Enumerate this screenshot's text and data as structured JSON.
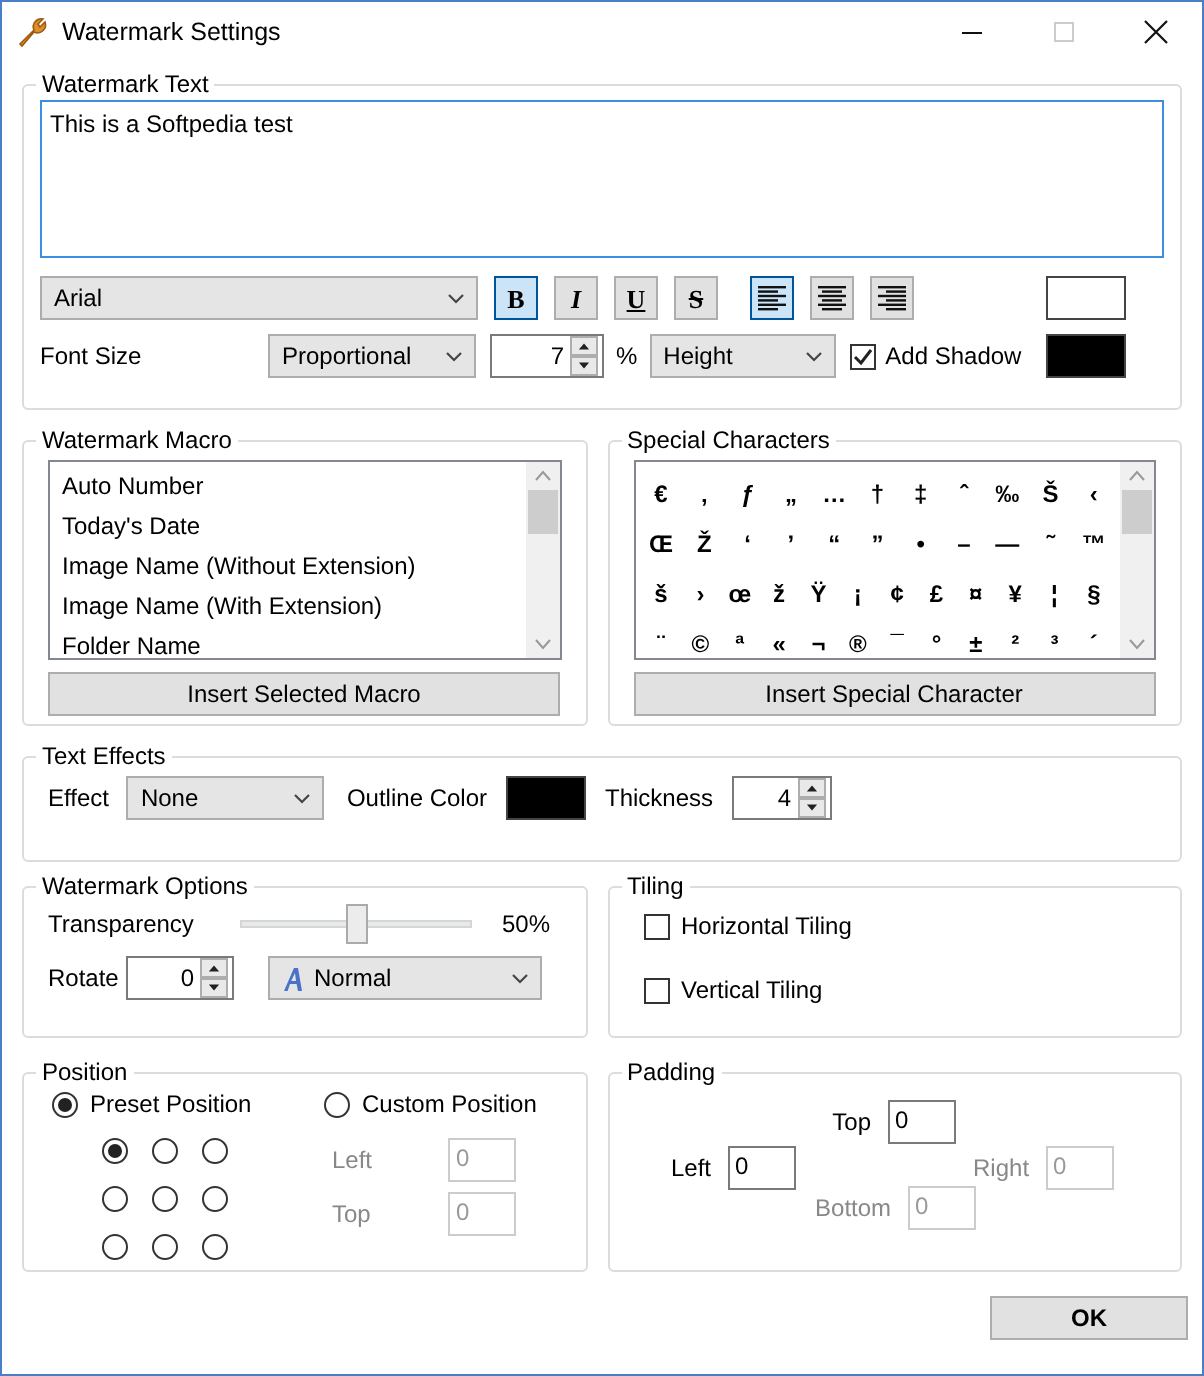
{
  "window": {
    "title": "Watermark Settings",
    "maximize_disabled": true
  },
  "watermark_text": {
    "title": "Watermark Text",
    "value": "This is a Softpedia test",
    "font": "Arial",
    "style_buttons": [
      {
        "kind": "bold",
        "label": "B",
        "selected": true
      },
      {
        "kind": "italic",
        "label": "I",
        "selected": false
      },
      {
        "kind": "underline",
        "label": "U",
        "selected": false
      },
      {
        "kind": "strike",
        "label": "S",
        "selected": false
      }
    ],
    "align_buttons": [
      {
        "kind": "left",
        "selected": true
      },
      {
        "kind": "center",
        "selected": false
      },
      {
        "kind": "right",
        "selected": false
      }
    ],
    "text_swatch": {
      "color": "#ffffff"
    },
    "font_size_label": "Font Size",
    "size_mode": "Proportional",
    "size_value": "7",
    "size_unit": "%",
    "size_basis": "Height",
    "shadow": {
      "label": "Add Shadow",
      "checked": true
    },
    "shadow_swatch": {
      "color": "#000000"
    }
  },
  "watermark_macro": {
    "title": "Watermark Macro",
    "items": [
      "Auto Number",
      "Today's Date",
      "Image Name (Without Extension)",
      "Image Name (With Extension)",
      "Folder Name"
    ],
    "button": "Insert Selected Macro"
  },
  "special_characters": {
    "title": "Special Characters",
    "rows": [
      [
        "€",
        "‚",
        "ƒ",
        "„",
        "…",
        "†",
        "‡",
        "ˆ",
        "‰",
        "Š",
        "‹"
      ],
      [
        "Œ",
        "Ž",
        "‘",
        "’",
        "“",
        "”",
        "•",
        "–",
        "—",
        "˜",
        "™"
      ],
      [
        "š",
        "›",
        "œ",
        "ž",
        "Ÿ",
        "¡",
        "¢",
        "£",
        "¤",
        "¥",
        "¦",
        "§"
      ],
      [
        "¨",
        "©",
        "ª",
        "«",
        "¬",
        "®",
        "¯",
        "°",
        "±",
        "²",
        "³",
        "´"
      ]
    ],
    "button": "Insert Special Character"
  },
  "text_effects": {
    "title": "Text Effects",
    "effect_label": "Effect",
    "effect": "None",
    "outline_label": "Outline Color",
    "outline_swatch": {
      "color": "#000000"
    },
    "thickness_label": "Thickness",
    "thickness": "4"
  },
  "watermark_options": {
    "title": "Watermark Options",
    "transparency_label": "Transparency",
    "level": 0.5,
    "reading": "50%",
    "rotate_label": "Rotate",
    "rotate": "0",
    "style": "Normal"
  },
  "tiling": {
    "title": "Tiling",
    "items": [
      {
        "label": "Horizontal Tiling",
        "checked": false
      },
      {
        "label": "Vertical Tiling",
        "checked": false
      }
    ]
  },
  "position": {
    "title": "Position",
    "modes": [
      {
        "label": "Preset Position",
        "selected": true
      },
      {
        "label": "Custom Position",
        "selected": false
      }
    ],
    "grid": [
      {
        "selected": true
      },
      {
        "selected": false
      },
      {
        "selected": false
      },
      {
        "selected": false
      },
      {
        "selected": false
      },
      {
        "selected": false
      },
      {
        "selected": false
      },
      {
        "selected": false
      },
      {
        "selected": false
      }
    ],
    "fields": [
      {
        "label": "Left",
        "value": "0",
        "disabled": true
      },
      {
        "label": "Top",
        "value": "0",
        "disabled": true
      }
    ]
  },
  "padding": {
    "title": "Padding",
    "fields": [
      {
        "kind": "top",
        "label": "Top",
        "value": "0",
        "disabled": false
      },
      {
        "kind": "left",
        "label": "Left",
        "value": "0",
        "disabled": false
      },
      {
        "kind": "right",
        "label": "Right",
        "value": "0",
        "disabled": true
      },
      {
        "kind": "bottom",
        "label": "Bottom",
        "value": "0",
        "disabled": true
      }
    ]
  },
  "ok_button": "OK"
}
